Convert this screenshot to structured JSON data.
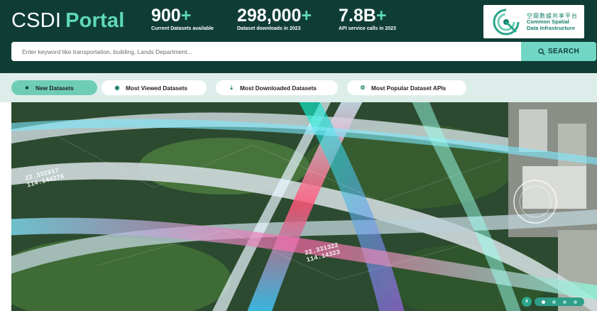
{
  "brand": {
    "word1": "CSDI",
    "word2": "Portal"
  },
  "stats": [
    {
      "number": "900",
      "suffix": "+",
      "caption": "Current Datasets available"
    },
    {
      "number": "298,000",
      "suffix": "+",
      "caption": "Dataset downloads in 2023"
    },
    {
      "number": "7.8B",
      "suffix": "+",
      "caption": "API service calls in 2023"
    }
  ],
  "logo": {
    "chinese": "空間數據共享平台",
    "english_line1": "Common Spatial",
    "english_line2": "Data Infrastructure"
  },
  "search": {
    "placeholder": "Enter keyword like transportation, building, Lands Department...",
    "value": "",
    "button_label": "SEARCH",
    "button_icon": "search-icon"
  },
  "tabs": [
    {
      "label": "New Datasets",
      "icon": "folder-icon",
      "active": true
    },
    {
      "label": "Most Viewed Datasets",
      "icon": "eye-icon",
      "active": false
    },
    {
      "label": "Most Downloaded Datasets",
      "icon": "download-icon",
      "active": false
    },
    {
      "label": "Most Popular Dataset APIs",
      "icon": "api-icon",
      "active": false
    }
  ],
  "hero": {
    "coord1_lat": "22.332917",
    "coord1_lon": "114.144276",
    "coord2_lat": "22.331322",
    "coord2_lon": "114.14323"
  },
  "carousel": {
    "pause_symbol": "II",
    "total_slides": 4,
    "current_slide": 1
  },
  "colors": {
    "header_bg": "#0f3d36",
    "accent": "#5fd9b8",
    "search_button": "#72d6c4",
    "tabs_bg": "#ddeeea",
    "active_tab": "#6fcdb6"
  }
}
